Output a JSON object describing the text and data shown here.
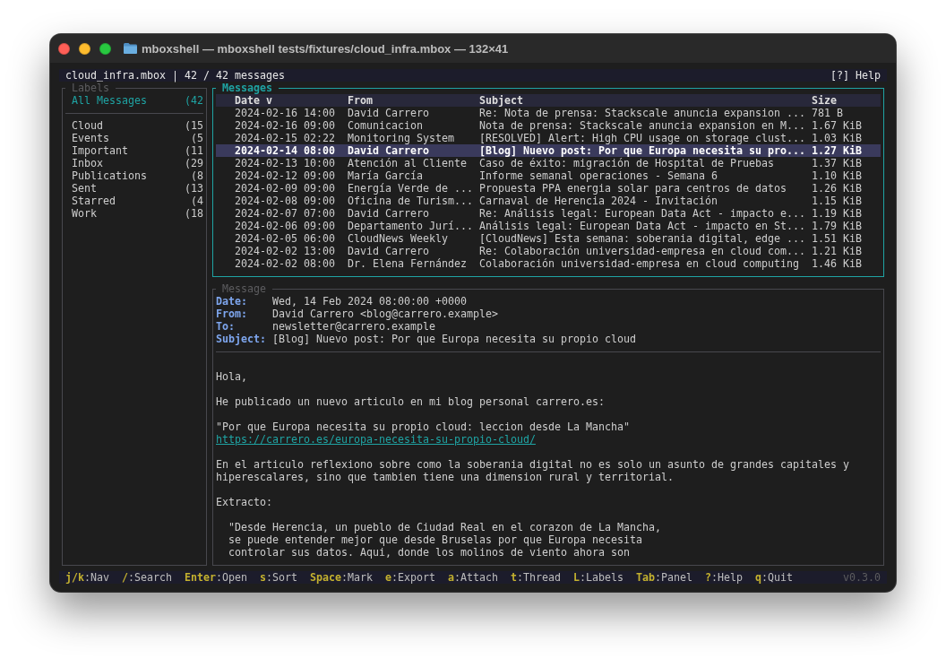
{
  "window": {
    "title": "mboxshell — mboxshell tests/fixtures/cloud_infra.mbox — 132×41"
  },
  "status_bar": {
    "mailbox": "cloud_infra.mbox | 42 / 42 messages",
    "help": "[?] Help"
  },
  "labels_panel": {
    "title": "Labels",
    "all_messages": {
      "name": "All Messages",
      "count": "(42",
      "selected": true
    },
    "items": [
      {
        "name": "Cloud",
        "count": "(15",
        "selected": false
      },
      {
        "name": "Events",
        "count": "(5",
        "selected": false
      },
      {
        "name": "Important",
        "count": "(11",
        "selected": false
      },
      {
        "name": "Inbox",
        "count": "(29",
        "selected": false
      },
      {
        "name": "Publications",
        "count": "(8",
        "selected": false
      },
      {
        "name": "Sent",
        "count": "(13",
        "selected": false
      },
      {
        "name": "Starred",
        "count": "(4",
        "selected": false
      },
      {
        "name": "Work",
        "count": "(18",
        "selected": false
      }
    ]
  },
  "messages_panel": {
    "title": "Messages",
    "columns": [
      "Date v",
      "From",
      "Subject",
      "Size"
    ],
    "rows": [
      {
        "date": "2024-02-16 14:00",
        "from": "David Carrero",
        "subject": "Re: Nota de prensa: Stackscale anuncia expansion ...",
        "size": "781 B",
        "selected": false
      },
      {
        "date": "2024-02-16 09:00",
        "from": "Comunicacion",
        "subject": "Nota de prensa: Stackscale anuncia expansion en M...",
        "size": "1.67 KiB",
        "selected": false
      },
      {
        "date": "2024-02-15 02:22",
        "from": "Monitoring System",
        "subject": "[RESOLVED] Alert: High CPU usage on storage clust...",
        "size": "1.03 KiB",
        "selected": false
      },
      {
        "date": "2024-02-14 08:00",
        "from": "David Carrero",
        "subject": "[Blog] Nuevo post: Por que Europa necesita su pro...",
        "size": "1.27 KiB",
        "selected": true
      },
      {
        "date": "2024-02-13 10:00",
        "from": "Atención al Cliente",
        "subject": "Caso de éxito: migración de Hospital de Pruebas",
        "size": "1.37 KiB",
        "selected": false
      },
      {
        "date": "2024-02-12 09:00",
        "from": "María García",
        "subject": "Informe semanal operaciones - Semana 6",
        "size": "1.10 KiB",
        "selected": false
      },
      {
        "date": "2024-02-09 09:00",
        "from": "Energía Verde de ...",
        "subject": "Propuesta PPA energia solar para centros de datos",
        "size": "1.26 KiB",
        "selected": false
      },
      {
        "date": "2024-02-08 09:00",
        "from": "Oficina de Turism...",
        "subject": "Carnaval de Herencia 2024 - Invitación",
        "size": "1.15 KiB",
        "selected": false
      },
      {
        "date": "2024-02-07 07:00",
        "from": "David Carrero",
        "subject": "Re: Análisis legal: European Data Act - impacto e...",
        "size": "1.19 KiB",
        "selected": false
      },
      {
        "date": "2024-02-06 09:00",
        "from": "Departamento Jurí...",
        "subject": "Análisis legal: European Data Act - impacto en St...",
        "size": "1.79 KiB",
        "selected": false
      },
      {
        "date": "2024-02-05 06:00",
        "from": "CloudNews Weekly",
        "subject": "[CloudNews] Esta semana: soberania digital, edge ...",
        "size": "1.51 KiB",
        "selected": false
      },
      {
        "date": "2024-02-02 13:00",
        "from": "David Carrero",
        "subject": "Re: Colaboración universidad-empresa en cloud com...",
        "size": "1.21 KiB",
        "selected": false
      },
      {
        "date": "2024-02-02 08:00",
        "from": "Dr. Elena Fernández",
        "subject": "Colaboración universidad-empresa en cloud computing",
        "size": "1.46 KiB",
        "selected": false
      }
    ]
  },
  "message_panel": {
    "title": "Message",
    "headers": [
      {
        "label": "Date:",
        "value": "Wed, 14 Feb 2024 08:00:00 +0000"
      },
      {
        "label": "From:",
        "value": "David Carrero <blog@carrero.example>"
      },
      {
        "label": "To:",
        "value": "newsletter@carrero.example"
      },
      {
        "label": "Subject:",
        "value": "[Blog] Nuevo post: Por que Europa necesita su propio cloud"
      }
    ],
    "body": [
      {
        "kind": "text",
        "lines": [
          "Hola,"
        ]
      },
      {
        "kind": "text",
        "lines": [
          "He publicado un nuevo articulo en mi blog personal carrero.es:"
        ]
      },
      {
        "kind": "text",
        "lines": [
          "\"Por que Europa necesita su propio cloud: leccion desde La Mancha\""
        ],
        "link": "https://carrero.es/europa-necesita-su-propio-cloud/"
      },
      {
        "kind": "text",
        "lines": [
          "En el articulo reflexiono sobre como la soberania digital no es solo un asunto de grandes capitales y",
          "hiperescalares, sino que tambien tiene una dimension rural y territorial."
        ]
      },
      {
        "kind": "text",
        "lines": [
          "Extracto:"
        ]
      },
      {
        "kind": "quote",
        "lines": [
          "\"Desde Herencia, un pueblo de Ciudad Real en el corazon de La Mancha,",
          "se puede entender mejor que desde Bruselas por que Europa necesita",
          "controlar sus datos. Aqui, donde los molinos de viento ahora son"
        ]
      }
    ]
  },
  "footer": {
    "shortcuts": [
      {
        "key": "j/k",
        "action": ":Nav"
      },
      {
        "key": "/",
        "action": ":Search"
      },
      {
        "key": "Enter",
        "action": ":Open"
      },
      {
        "key": "s",
        "action": ":Sort"
      },
      {
        "key": "Space",
        "action": ":Mark"
      },
      {
        "key": "e",
        "action": ":Export"
      },
      {
        "key": "a",
        "action": ":Attach"
      },
      {
        "key": "t",
        "action": ":Thread"
      },
      {
        "key": "L",
        "action": ":Labels"
      },
      {
        "key": "Tab",
        "action": ":Panel"
      },
      {
        "key": "?",
        "action": ":Help"
      },
      {
        "key": "q",
        "action": ":Quit"
      }
    ],
    "version": "v0.3.0"
  }
}
